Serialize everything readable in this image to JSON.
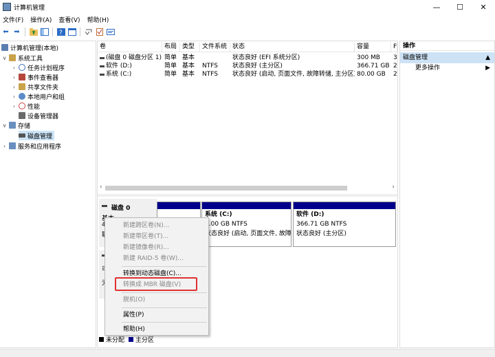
{
  "window": {
    "title": "计算机管理",
    "minimize": "—",
    "maximize": "☐",
    "close": "✕"
  },
  "menu": [
    "文件(F)",
    "操作(A)",
    "查看(V)",
    "帮助(H)"
  ],
  "toolbar_icons": [
    "back-arrow-icon",
    "forward-arrow-icon",
    "folder-up-icon",
    "show-hide-tree-icon",
    "help-icon",
    "properties-icon",
    "refresh-icon",
    "check-icon",
    "export-icon"
  ],
  "tree": [
    {
      "label": "计算机管理(本地)",
      "exp": "",
      "color": "#5a7fb0"
    },
    {
      "label": "系统工具",
      "exp": "∨",
      "color": "#c9a24a"
    },
    {
      "label": "任务计划程序",
      "exp": "›",
      "color": "#3d6db5"
    },
    {
      "label": "事件查看器",
      "exp": "›",
      "color": "#b5473d"
    },
    {
      "label": "共享文件夹",
      "exp": "›",
      "color": "#c9a24a"
    },
    {
      "label": "本地用户和组",
      "exp": "›",
      "color": "#5b8bc9"
    },
    {
      "label": "性能",
      "exp": "›",
      "color": "#d04040"
    },
    {
      "label": "设备管理器",
      "exp": "",
      "color": "#6a6a6a"
    },
    {
      "label": "存储",
      "exp": "∨",
      "color": "#6a8fbf"
    },
    {
      "label": "磁盘管理",
      "exp": "",
      "color": "#555"
    },
    {
      "label": "服务和应用程序",
      "exp": "›",
      "color": "#6a8fbf"
    }
  ],
  "volumes": {
    "headers": [
      "卷",
      "布局",
      "类型",
      "文件系统",
      "状态",
      "容量",
      "F"
    ],
    "rows": [
      [
        "(磁盘 0 磁盘分区 1)",
        "简单",
        "基本",
        "",
        "状态良好 (EFI 系统分区)",
        "300 MB",
        "3"
      ],
      [
        "软件 (D:)",
        "简单",
        "基本",
        "NTFS",
        "状态良好 (主分区)",
        "366.71 GB",
        "2"
      ],
      [
        "系统 (C:)",
        "简单",
        "基本",
        "NTFS",
        "状态良好 (启动, 页面文件, 故障转储, 主分区)",
        "80.00 GB",
        "2"
      ]
    ]
  },
  "disk0": {
    "name": "磁盘 0",
    "type": "基本",
    "size_partial": "4",
    "status_partial": "联"
  },
  "partitions": [
    {
      "title": "",
      "size": "",
      "status": ""
    },
    {
      "title": "系统 (C:)",
      "size": "0.00 GB NTFS",
      "status": "状态良好 (启动, 页面文件, 故障"
    },
    {
      "title": "软件 (D:)",
      "size": "366.71 GB NTFS",
      "status": "状态良好 (主分区)"
    }
  ],
  "disk1": {
    "l1": "可",
    "l2": "无"
  },
  "legend": [
    {
      "label": "未分配",
      "color": "#000000"
    },
    {
      "label": "主分区",
      "color": "#00008b"
    }
  ],
  "actions": {
    "header": "操作",
    "section": "磁盘管理",
    "more": "更多操作"
  },
  "context_menu": {
    "items": [
      "新建跨区卷(N)...",
      "新建带区卷(T)...",
      "新建镜像卷(R)...",
      "新建 RAID-5 卷(W)...",
      "转换到动态磁盘(C)...",
      "转换成 MBR 磁盘(V)",
      "脱机(O)",
      "属性(P)",
      "帮助(H)"
    ]
  }
}
